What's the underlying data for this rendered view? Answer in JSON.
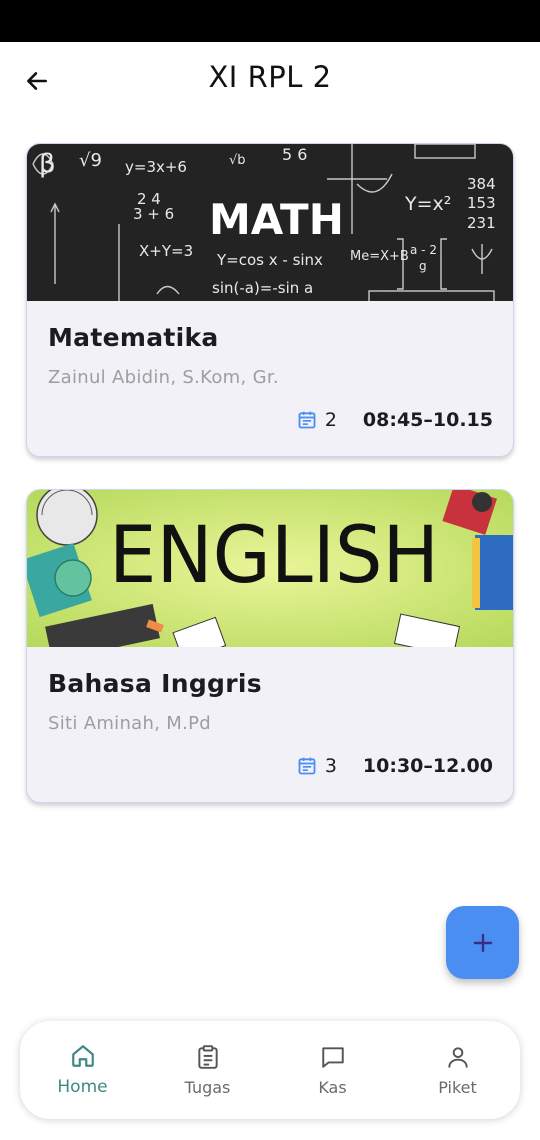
{
  "appbar": {
    "title": "XI RPL 2",
    "back_icon": "arrow-left-icon"
  },
  "classes": [
    {
      "subject": "Matematika",
      "teacher": "Zainul Abidin, S.Kom, Gr.",
      "day": "2",
      "time": "08:45–10.15",
      "banner_word": "MATH",
      "banner_formulas": [
        "y=3x+6",
        "X+Y=3",
        "Y=cos x - sinx",
        "sin(-a)=-sin a",
        "Y=x²",
        "384/153/231",
        "Me=X+B",
        "2/3 + 4/6",
        "√b"
      ]
    },
    {
      "subject": "Bahasa Inggris",
      "teacher": "Siti Aminah, M.Pd",
      "day": "3",
      "time": "10:30–12.00",
      "banner_word": "ENGLISH",
      "banner_formulas": []
    }
  ],
  "fab": {
    "icon": "plus-icon"
  },
  "bottom_nav": [
    {
      "label": "Home",
      "icon": "home-icon",
      "active": true
    },
    {
      "label": "Tugas",
      "icon": "clipboard-icon",
      "active": false
    },
    {
      "label": "Kas",
      "icon": "chat-icon",
      "active": false
    },
    {
      "label": "Piket",
      "icon": "person-icon",
      "active": false
    }
  ],
  "colors": {
    "accent": "#3e8a82",
    "fab": "#4a8ef2",
    "card_bg": "#f3f1f8",
    "calendar_icon": "#4a8ef2"
  }
}
